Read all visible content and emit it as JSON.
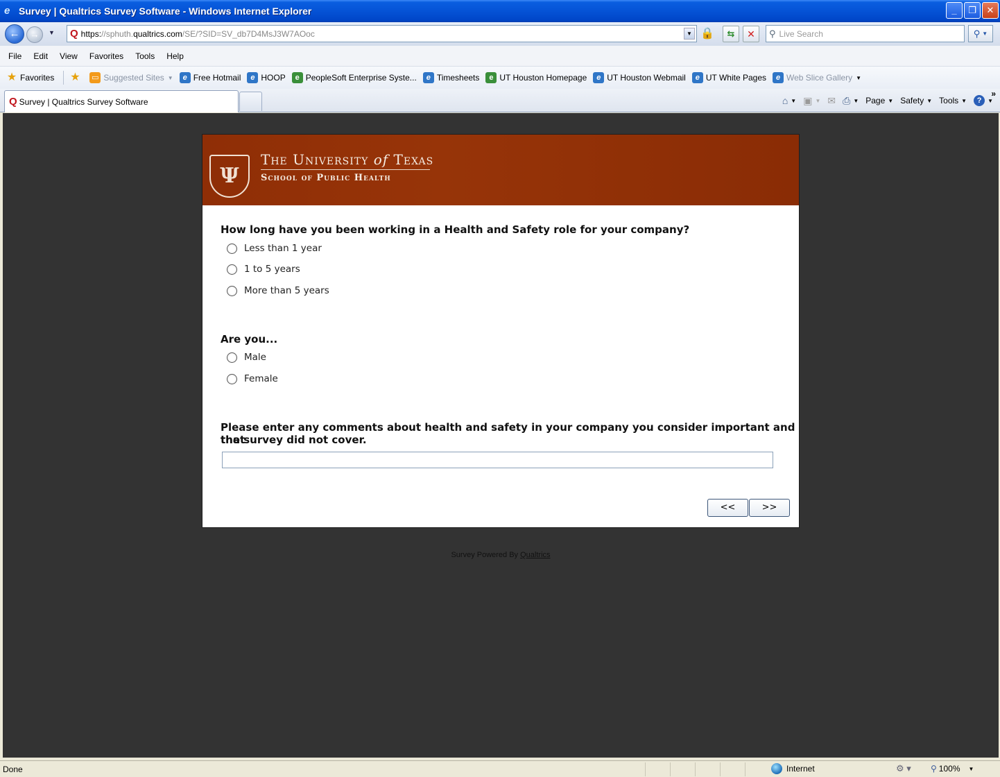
{
  "window": {
    "title": "Survey | Qualtrics Survey Software - Windows Internet Explorer",
    "buttons": {
      "minimize": "_",
      "restore": "❐",
      "close": "✕"
    }
  },
  "address_bar": {
    "scheme": "https:",
    "prefix": "//sphuth.",
    "host": "qualtrics.com",
    "path": "/SE/?SID=SV_db7D4MsJ3W7AOoc",
    "search_placeholder": "Live Search"
  },
  "menu": [
    "File",
    "Edit",
    "View",
    "Favorites",
    "Tools",
    "Help"
  ],
  "favorites_bar": {
    "favorites_label": "Favorites",
    "items": [
      {
        "label": "Suggested Sites",
        "dim": true,
        "icon": "suggested-sites-icon"
      },
      {
        "label": "Free Hotmail",
        "icon": "ie-page-icon"
      },
      {
        "label": "HOOP",
        "icon": "ie-page-icon"
      },
      {
        "label": "PeopleSoft Enterprise Syste...",
        "icon": "ie-page-icon"
      },
      {
        "label": "Timesheets",
        "icon": "ie-page-icon"
      },
      {
        "label": "UT Houston Homepage",
        "icon": "ie-page-icon"
      },
      {
        "label": "UT Houston Webmail",
        "icon": "ie-page-icon"
      },
      {
        "label": "UT White Pages",
        "icon": "ie-page-icon"
      },
      {
        "label": "Web Slice Gallery",
        "dim": true,
        "icon": "ie-page-icon"
      }
    ]
  },
  "tabs": {
    "active_label": "Survey | Qualtrics Survey Software",
    "commands": [
      "Page",
      "Safety",
      "Tools"
    ]
  },
  "survey": {
    "header": {
      "university_pre": "The University",
      "university_of": "of",
      "university_post": "Texas",
      "school": "School of Public Health"
    },
    "q1": {
      "text": "How long have you been working in a Health and Safety role for your company?",
      "choices": [
        "Less than 1 year",
        "1 to 5 years",
        "More than 5 years"
      ]
    },
    "q2": {
      "text": "Are you...",
      "choices": [
        "Male",
        "Female"
      ]
    },
    "q3": {
      "text_line1": "Please enter any comments about health and safety in your company you consider important and that",
      "text_line2": "the survey did not cover.",
      "value": ""
    },
    "back_label": "<<",
    "next_label": ">>",
    "powered_by": "Survey Powered By",
    "powered_link": "Qualtrics"
  },
  "status_bar": {
    "status": "Done",
    "zone": "Internet",
    "zoom": "100%"
  },
  "colors": {
    "header_bg": "#8f2e06",
    "page_bg": "#333333",
    "titlebar": "#0553d6"
  }
}
